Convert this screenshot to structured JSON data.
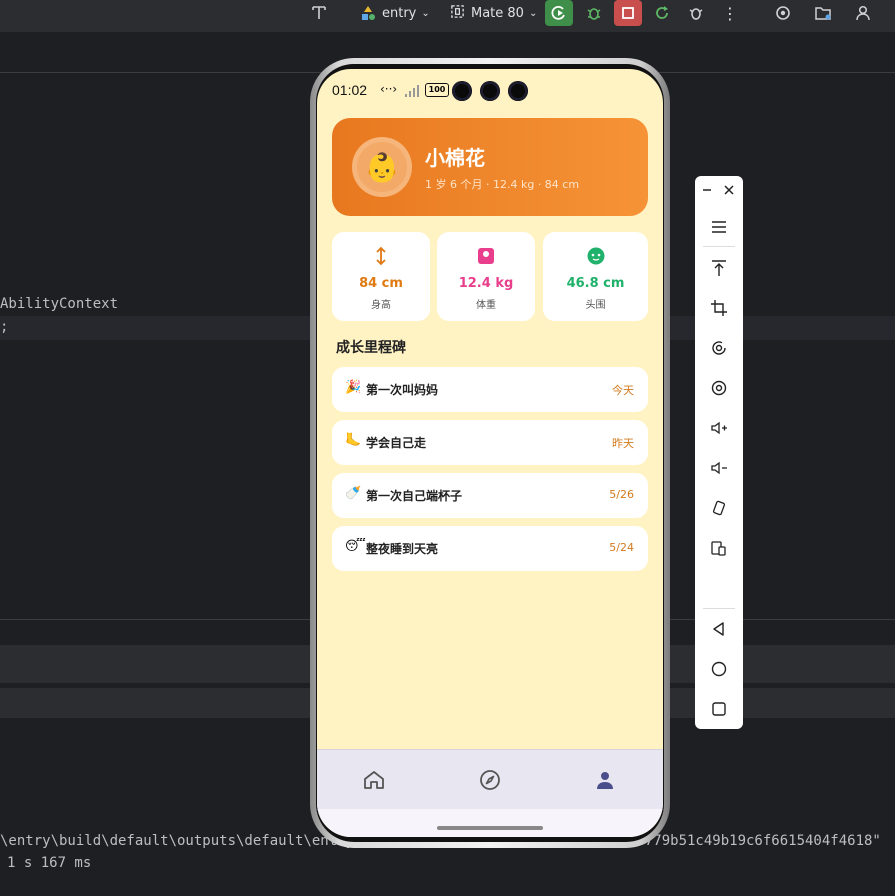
{
  "ide": {
    "run_config": "entry",
    "device": "Mate 80",
    "code_lines": [
      "AbilityContext",
      ";"
    ],
    "console_path": "\\entry\\build\\default\\outputs\\default\\entry",
    "console_hash": "ab779b51c49b19c6f6615404f4618\"",
    "console_time": "1 s 167 ms"
  },
  "status_bar": {
    "time": "01:02",
    "battery": "100"
  },
  "profile": {
    "avatar_emoji": "👶",
    "name": "小棉花",
    "meta": "1 岁 6 个月 · 12.4 kg · 84 cm"
  },
  "stats": [
    {
      "value": "84 cm",
      "label": "身高",
      "color": "#e07a12"
    },
    {
      "value": "12.4 kg",
      "label": "体重",
      "color": "#e83e8c"
    },
    {
      "value": "46.8 cm",
      "label": "头围",
      "color": "#20b26b"
    }
  ],
  "milestones": {
    "title": "成长里程碑",
    "items": [
      {
        "emoji": "🎉",
        "title": "第一次叫妈妈",
        "date": "今天"
      },
      {
        "emoji": "🦶",
        "title": "学会自己走",
        "date": "昨天"
      },
      {
        "emoji": "🍼",
        "title": "第一次自己端杯子",
        "date": "5/26"
      },
      {
        "emoji": "😴",
        "title": "整夜睡到天亮",
        "date": "5/24"
      }
    ]
  },
  "tabs": [
    "home-icon",
    "compass-icon",
    "person-icon"
  ],
  "colors": {
    "page_bg": "#fff3c4",
    "accent_orange": "#f0892e",
    "tab_active": "#4a4f8c"
  }
}
